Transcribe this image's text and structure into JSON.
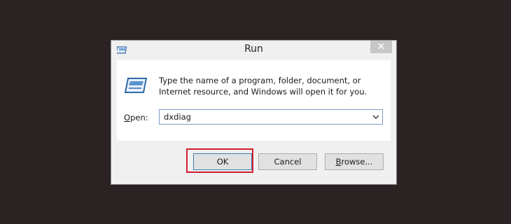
{
  "dialog": {
    "title": "Run",
    "close_glyph": "✕",
    "message": "Type the name of a program, folder, document, or Internet resource, and Windows will open it for you.",
    "open_label_accel": "O",
    "open_label_rest": "pen:",
    "open_value": "dxdiag",
    "buttons": {
      "ok": "OK",
      "cancel": "Cancel",
      "browse_accel": "B",
      "browse_rest": "rowse..."
    }
  },
  "colors": {
    "desktop_bg": "#2b2323",
    "highlight": "#d21d2f",
    "dialog_bg": "#f0f0f0"
  },
  "icons": {
    "title": "run-icon",
    "main": "run-icon",
    "dropdown": "chevron-down-icon",
    "close": "close-icon"
  }
}
